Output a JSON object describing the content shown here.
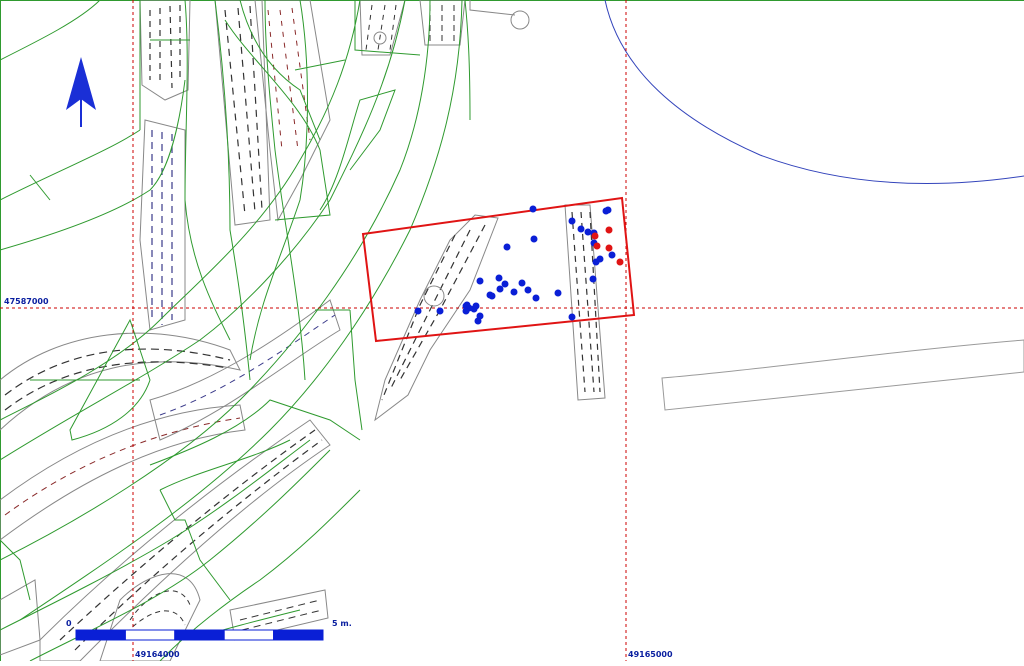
{
  "grid": {
    "northing_label": "47587000",
    "easting_labels": [
      "49164000",
      "49165000"
    ]
  },
  "scale_bar": {
    "start_label": "0",
    "end_label": "5 m.",
    "segments": 5
  },
  "north_arrow": {
    "icon": "north-arrow-icon"
  },
  "colors": {
    "grid": "#cc0000",
    "contours": "#2f9a2f",
    "trenches": "#9a9a9a",
    "excavation_area": "#e01414",
    "finds_blue": "#0a1fd6",
    "finds_red": "#e01414",
    "water_edge": "#3344bb",
    "label": "#0a1fa0"
  },
  "finds": {
    "blue_count": 36,
    "red_count": 5
  }
}
